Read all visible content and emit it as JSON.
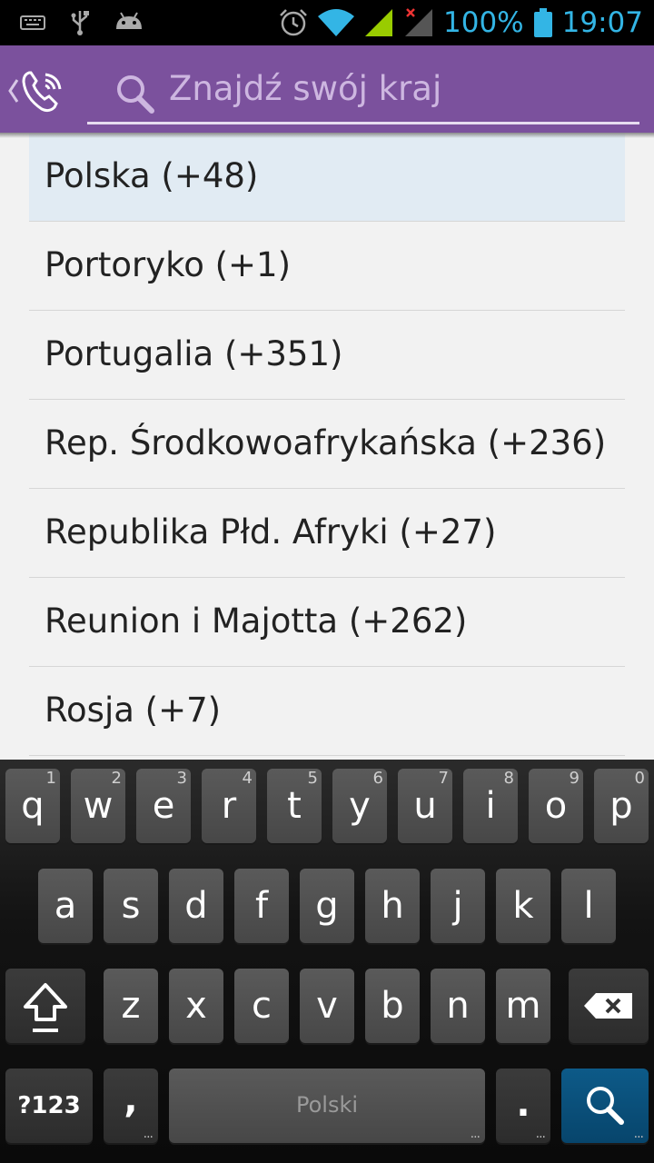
{
  "status_bar": {
    "battery_percent": "100%",
    "time": "19:07",
    "icons": [
      "keyboard-icon",
      "usb-icon",
      "android-icon",
      "alarm-icon",
      "wifi-icon",
      "signal-icon",
      "signal-no-service-icon",
      "battery-icon"
    ],
    "accent_color": "#33b5e5"
  },
  "action_bar": {
    "color": "#7b519d",
    "search_placeholder": "Znajdź swój kraj"
  },
  "countries": [
    {
      "label": "Polska (+48)",
      "selected": true
    },
    {
      "label": "Portoryko (+1)"
    },
    {
      "label": "Portugalia (+351)"
    },
    {
      "label": "Rep. Środkowoafrykańska (+236)"
    },
    {
      "label": "Republika Płd. Afryki (+27)"
    },
    {
      "label": "Reunion i Majotta (+262)"
    },
    {
      "label": "Rosja (+7)"
    }
  ],
  "keyboard": {
    "row1": [
      {
        "ch": "q",
        "hint": "1"
      },
      {
        "ch": "w",
        "hint": "2"
      },
      {
        "ch": "e",
        "hint": "3"
      },
      {
        "ch": "r",
        "hint": "4"
      },
      {
        "ch": "t",
        "hint": "5"
      },
      {
        "ch": "y",
        "hint": "6"
      },
      {
        "ch": "u",
        "hint": "7"
      },
      {
        "ch": "i",
        "hint": "8"
      },
      {
        "ch": "o",
        "hint": "9"
      },
      {
        "ch": "p",
        "hint": "0"
      }
    ],
    "row2": [
      "a",
      "s",
      "d",
      "f",
      "g",
      "h",
      "j",
      "k",
      "l"
    ],
    "row3": [
      "z",
      "x",
      "c",
      "v",
      "b",
      "n",
      "m"
    ],
    "symbols_label": "?123",
    "comma": ",",
    "space_label": "Polski",
    "period": ".",
    "action_icon": "search-icon",
    "action_color": "#07456c"
  }
}
